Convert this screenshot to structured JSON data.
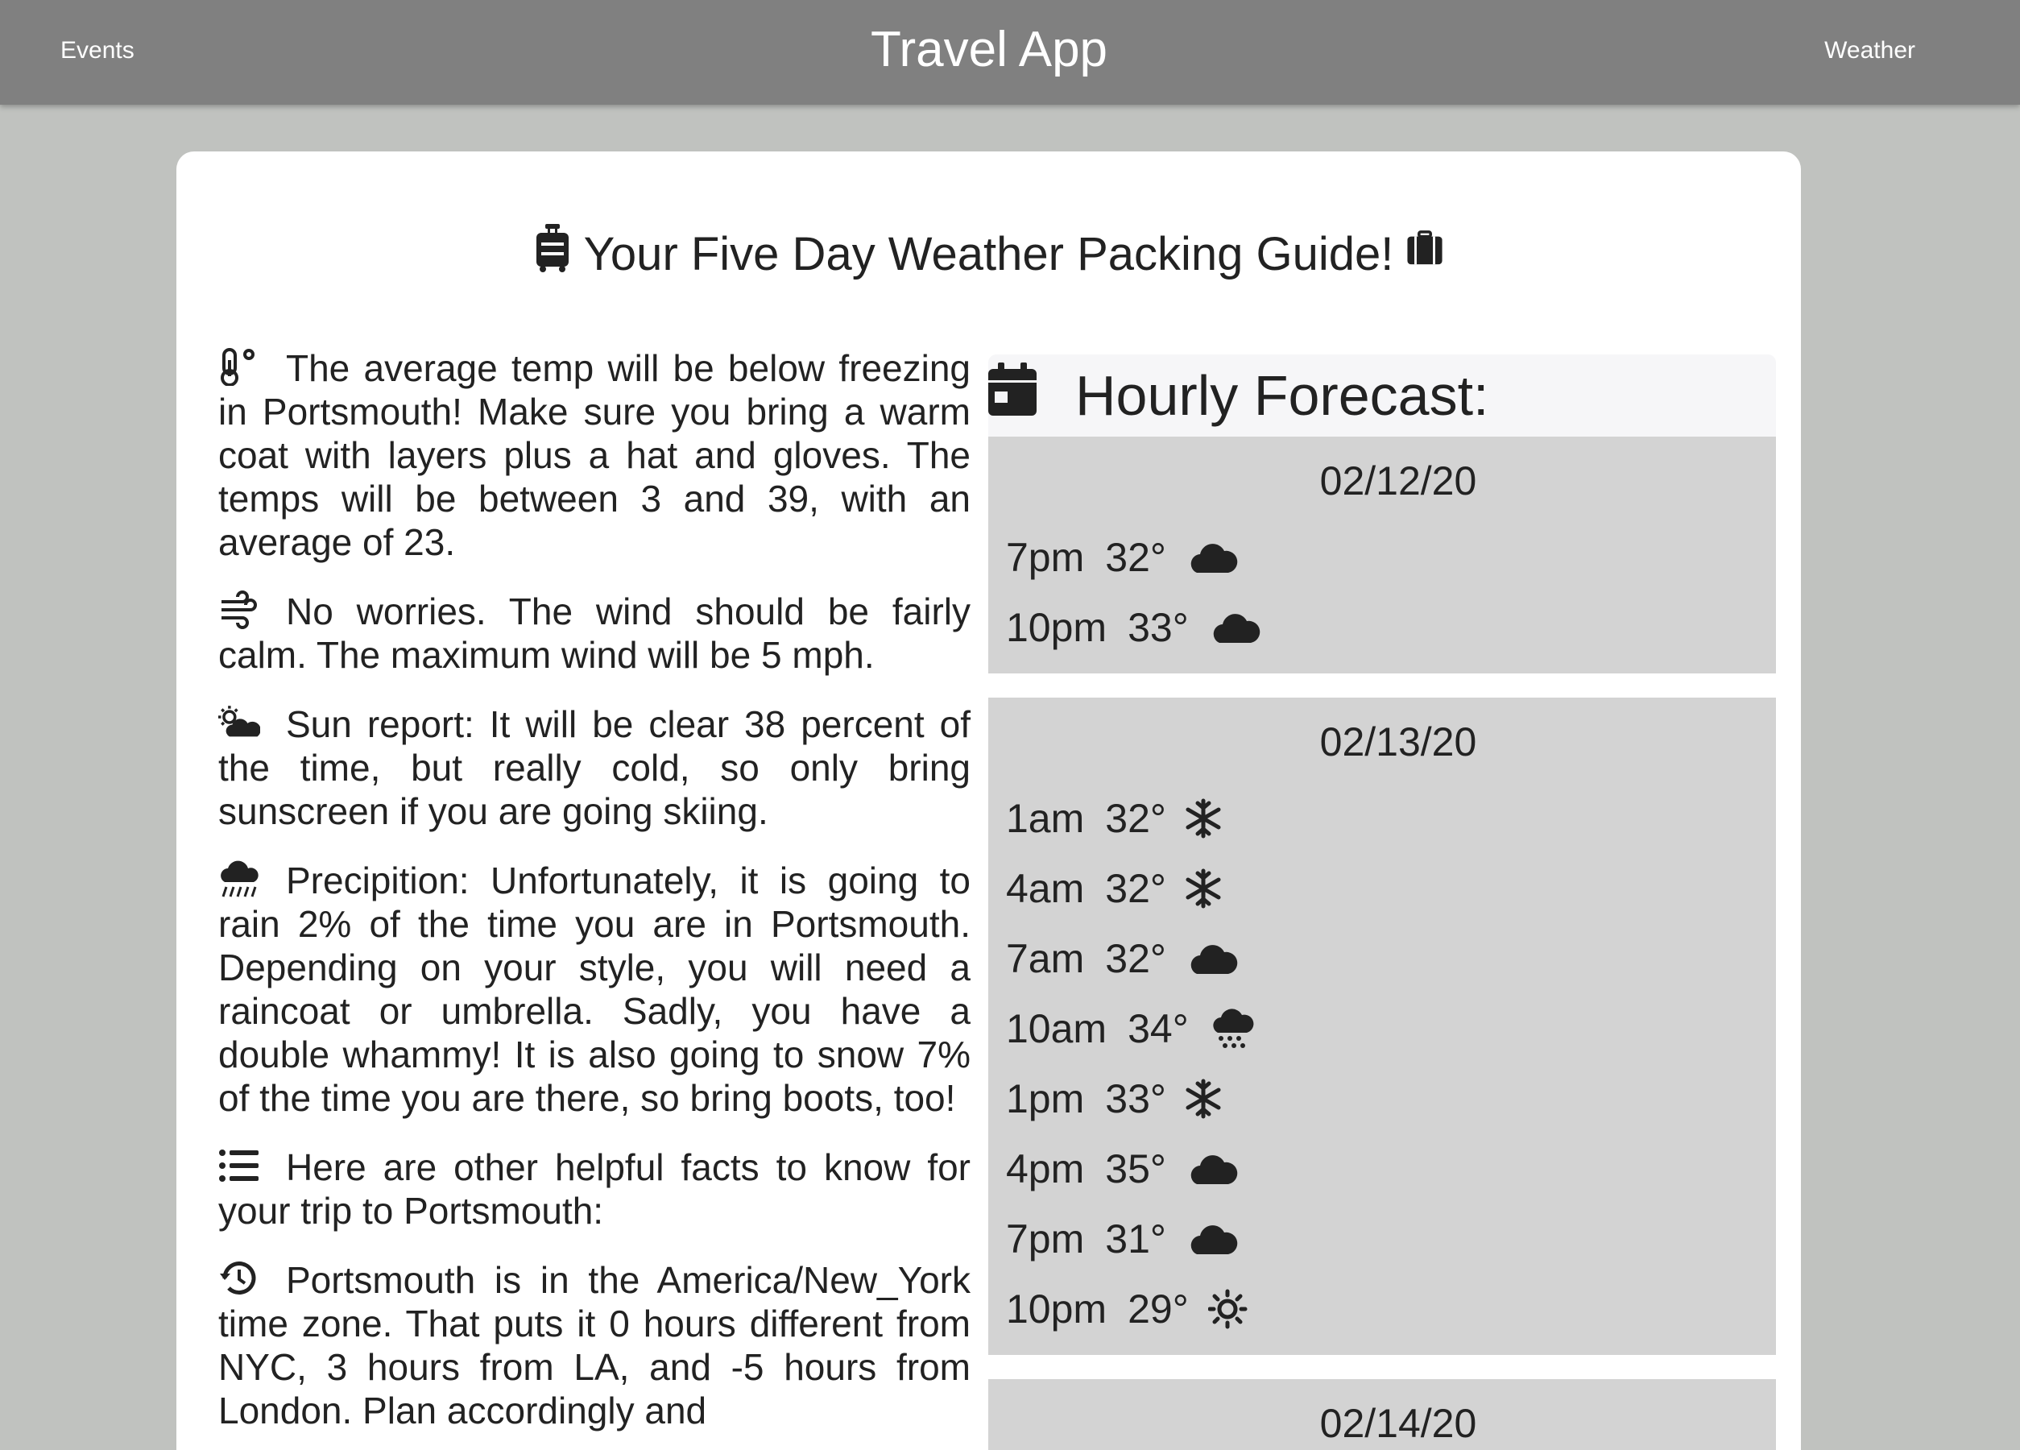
{
  "nav": {
    "brand": "Travel App",
    "events": "Events",
    "weather": "Weather"
  },
  "guide": {
    "title": "Your Five Day Weather Packing Guide!",
    "facts": [
      {
        "icon": "thermometer-icon",
        "text": "The average temp will be below freezing in Portsmouth! Make sure you bring a warm coat with layers plus a hat and gloves. The temps will be between 3 and 39, with an average of 23."
      },
      {
        "icon": "wind-icon",
        "text": "No worries. The wind should be fairly calm. The maximum wind will be 5 mph."
      },
      {
        "icon": "cloud-sun-icon",
        "text": "Sun report: It will be clear 38 percent of the time, but really cold, so only bring sunscreen if you are going skiing."
      },
      {
        "icon": "cloud-rain-icon",
        "text": "Precipition: Unfortunately, it is going to rain 2% of the time you are in Portsmouth. Depending on your style, you will need a raincoat or umbrella. Sadly, you have a double whammy! It is also going to snow 7% of the time you are there, so bring boots, too!"
      },
      {
        "icon": "list-icon",
        "text": "Here are other helpful facts to know for your trip to Portsmouth:"
      },
      {
        "icon": "history-icon",
        "text": "Portsmouth is in the America/New_York time zone. That puts it 0 hours different from NYC, 3 hours from LA, and -5 hours from London. Plan accordingly and"
      }
    ]
  },
  "forecast": {
    "header": "Hourly Forecast:",
    "days": [
      {
        "date": "02/12/20",
        "hours": [
          {
            "time": "7pm",
            "temp": "32°",
            "icon": "cloud"
          },
          {
            "time": "10pm",
            "temp": "33°",
            "icon": "cloud"
          }
        ]
      },
      {
        "date": "02/13/20",
        "hours": [
          {
            "time": "1am",
            "temp": "32°",
            "icon": "snowflake"
          },
          {
            "time": "4am",
            "temp": "32°",
            "icon": "snowflake"
          },
          {
            "time": "7am",
            "temp": "32°",
            "icon": "cloud"
          },
          {
            "time": "10am",
            "temp": "34°",
            "icon": "cloud-rain"
          },
          {
            "time": "1pm",
            "temp": "33°",
            "icon": "snowflake"
          },
          {
            "time": "4pm",
            "temp": "35°",
            "icon": "cloud"
          },
          {
            "time": "7pm",
            "temp": "31°",
            "icon": "cloud"
          },
          {
            "time": "10pm",
            "temp": "29°",
            "icon": "sun"
          }
        ]
      },
      {
        "date": "02/14/20",
        "hours": []
      }
    ]
  }
}
